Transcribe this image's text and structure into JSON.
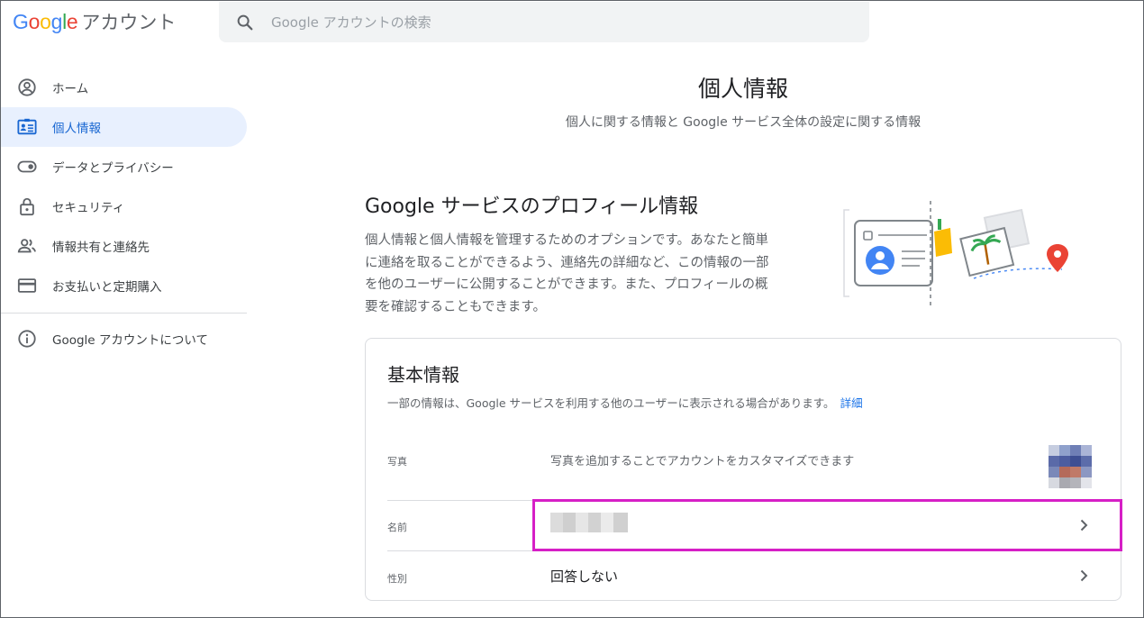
{
  "header": {
    "logo_google": "Google",
    "logo_product": "アカウント",
    "search_placeholder": "Google アカウントの検索"
  },
  "sidebar": {
    "items": [
      {
        "label": "ホーム",
        "icon": "account-circle-icon"
      },
      {
        "label": "個人情報",
        "icon": "id-card-icon",
        "active": true
      },
      {
        "label": "データとプライバシー",
        "icon": "toggle-icon"
      },
      {
        "label": "セキュリティ",
        "icon": "lock-icon"
      },
      {
        "label": "情報共有と連絡先",
        "icon": "people-icon"
      },
      {
        "label": "お支払いと定期購入",
        "icon": "credit-card-icon"
      }
    ],
    "about": {
      "label": "Google アカウントについて",
      "icon": "info-icon"
    }
  },
  "main": {
    "title": "個人情報",
    "subtitle": "個人に関する情報と Google サービス全体の設定に関する情報",
    "section_title": "Google サービスのプロフィール情報",
    "section_desc": "個人情報と個人情報を管理するためのオプションです。あなたと簡単に連絡を取ることができるよう、連絡先の詳細など、この情報の一部を他のユーザーに公開することができます。また、プロフィールの概要を確認することもできます。"
  },
  "card": {
    "title": "基本情報",
    "note": "一部の情報は、Google サービスを利用する他のユーザーに表示される場合があります。",
    "note_link": "詳細",
    "rows": [
      {
        "label": "写真",
        "value": "写真を追加することでアカウントをカスタマイズできます"
      },
      {
        "label": "名前",
        "value": ""
      },
      {
        "label": "性別",
        "value": "回答しない"
      }
    ]
  },
  "colors": {
    "accent_blue": "#1a73e8",
    "active_bg": "#e8f0fe",
    "highlight_magenta": "#d61fc6"
  }
}
